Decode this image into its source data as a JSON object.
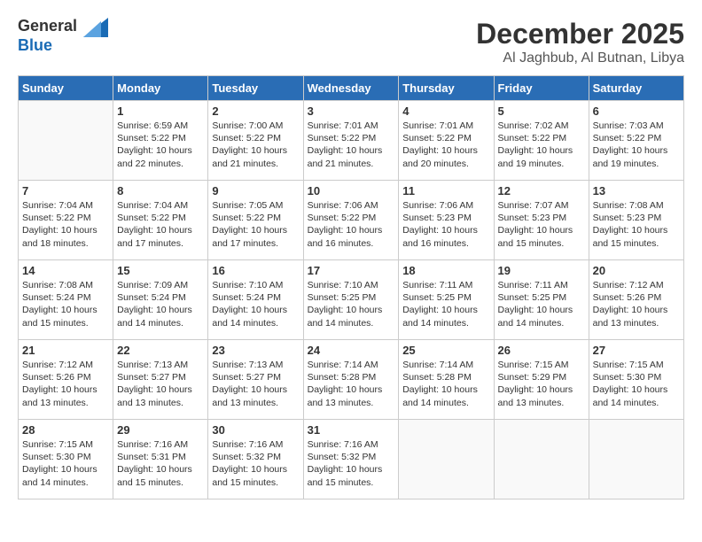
{
  "header": {
    "logo": {
      "general": "General",
      "blue": "Blue"
    },
    "title": "December 2025",
    "subtitle": "Al Jaghbub, Al Butnan, Libya"
  },
  "calendar": {
    "weekdays": [
      "Sunday",
      "Monday",
      "Tuesday",
      "Wednesday",
      "Thursday",
      "Friday",
      "Saturday"
    ],
    "weeks": [
      [
        {
          "day": "",
          "info": ""
        },
        {
          "day": "1",
          "info": "Sunrise: 6:59 AM\nSunset: 5:22 PM\nDaylight: 10 hours\nand 22 minutes."
        },
        {
          "day": "2",
          "info": "Sunrise: 7:00 AM\nSunset: 5:22 PM\nDaylight: 10 hours\nand 21 minutes."
        },
        {
          "day": "3",
          "info": "Sunrise: 7:01 AM\nSunset: 5:22 PM\nDaylight: 10 hours\nand 21 minutes."
        },
        {
          "day": "4",
          "info": "Sunrise: 7:01 AM\nSunset: 5:22 PM\nDaylight: 10 hours\nand 20 minutes."
        },
        {
          "day": "5",
          "info": "Sunrise: 7:02 AM\nSunset: 5:22 PM\nDaylight: 10 hours\nand 19 minutes."
        },
        {
          "day": "6",
          "info": "Sunrise: 7:03 AM\nSunset: 5:22 PM\nDaylight: 10 hours\nand 19 minutes."
        }
      ],
      [
        {
          "day": "7",
          "info": "Sunrise: 7:04 AM\nSunset: 5:22 PM\nDaylight: 10 hours\nand 18 minutes."
        },
        {
          "day": "8",
          "info": "Sunrise: 7:04 AM\nSunset: 5:22 PM\nDaylight: 10 hours\nand 17 minutes."
        },
        {
          "day": "9",
          "info": "Sunrise: 7:05 AM\nSunset: 5:22 PM\nDaylight: 10 hours\nand 17 minutes."
        },
        {
          "day": "10",
          "info": "Sunrise: 7:06 AM\nSunset: 5:22 PM\nDaylight: 10 hours\nand 16 minutes."
        },
        {
          "day": "11",
          "info": "Sunrise: 7:06 AM\nSunset: 5:23 PM\nDaylight: 10 hours\nand 16 minutes."
        },
        {
          "day": "12",
          "info": "Sunrise: 7:07 AM\nSunset: 5:23 PM\nDaylight: 10 hours\nand 15 minutes."
        },
        {
          "day": "13",
          "info": "Sunrise: 7:08 AM\nSunset: 5:23 PM\nDaylight: 10 hours\nand 15 minutes."
        }
      ],
      [
        {
          "day": "14",
          "info": "Sunrise: 7:08 AM\nSunset: 5:24 PM\nDaylight: 10 hours\nand 15 minutes."
        },
        {
          "day": "15",
          "info": "Sunrise: 7:09 AM\nSunset: 5:24 PM\nDaylight: 10 hours\nand 14 minutes."
        },
        {
          "day": "16",
          "info": "Sunrise: 7:10 AM\nSunset: 5:24 PM\nDaylight: 10 hours\nand 14 minutes."
        },
        {
          "day": "17",
          "info": "Sunrise: 7:10 AM\nSunset: 5:25 PM\nDaylight: 10 hours\nand 14 minutes."
        },
        {
          "day": "18",
          "info": "Sunrise: 7:11 AM\nSunset: 5:25 PM\nDaylight: 10 hours\nand 14 minutes."
        },
        {
          "day": "19",
          "info": "Sunrise: 7:11 AM\nSunset: 5:25 PM\nDaylight: 10 hours\nand 14 minutes."
        },
        {
          "day": "20",
          "info": "Sunrise: 7:12 AM\nSunset: 5:26 PM\nDaylight: 10 hours\nand 13 minutes."
        }
      ],
      [
        {
          "day": "21",
          "info": "Sunrise: 7:12 AM\nSunset: 5:26 PM\nDaylight: 10 hours\nand 13 minutes."
        },
        {
          "day": "22",
          "info": "Sunrise: 7:13 AM\nSunset: 5:27 PM\nDaylight: 10 hours\nand 13 minutes."
        },
        {
          "day": "23",
          "info": "Sunrise: 7:13 AM\nSunset: 5:27 PM\nDaylight: 10 hours\nand 13 minutes."
        },
        {
          "day": "24",
          "info": "Sunrise: 7:14 AM\nSunset: 5:28 PM\nDaylight: 10 hours\nand 13 minutes."
        },
        {
          "day": "25",
          "info": "Sunrise: 7:14 AM\nSunset: 5:28 PM\nDaylight: 10 hours\nand 14 minutes."
        },
        {
          "day": "26",
          "info": "Sunrise: 7:15 AM\nSunset: 5:29 PM\nDaylight: 10 hours\nand 13 minutes."
        },
        {
          "day": "27",
          "info": "Sunrise: 7:15 AM\nSunset: 5:30 PM\nDaylight: 10 hours\nand 14 minutes."
        }
      ],
      [
        {
          "day": "28",
          "info": "Sunrise: 7:15 AM\nSunset: 5:30 PM\nDaylight: 10 hours\nand 14 minutes."
        },
        {
          "day": "29",
          "info": "Sunrise: 7:16 AM\nSunset: 5:31 PM\nDaylight: 10 hours\nand 15 minutes."
        },
        {
          "day": "30",
          "info": "Sunrise: 7:16 AM\nSunset: 5:32 PM\nDaylight: 10 hours\nand 15 minutes."
        },
        {
          "day": "31",
          "info": "Sunrise: 7:16 AM\nSunset: 5:32 PM\nDaylight: 10 hours\nand 15 minutes."
        },
        {
          "day": "",
          "info": ""
        },
        {
          "day": "",
          "info": ""
        },
        {
          "day": "",
          "info": ""
        }
      ]
    ]
  }
}
